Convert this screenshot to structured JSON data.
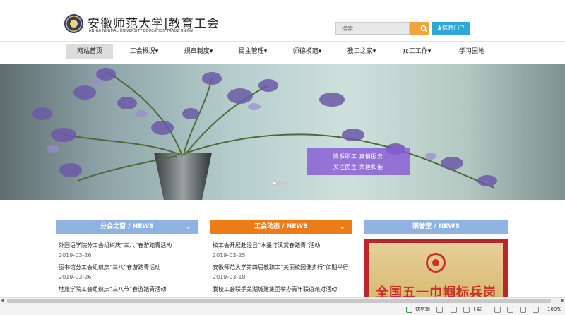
{
  "header": {
    "logo_cn": "安徽师范大学|教育工会",
    "logo_en": "ANHUI NORMAL UNIVERSITY EDUCATION    TRADE UNION",
    "search_placeholder": "搜索",
    "portal_label": "信息门户"
  },
  "nav": {
    "items": [
      {
        "label": "网站首页"
      },
      {
        "label": "工会概况▾"
      },
      {
        "label": "规章制度▾"
      },
      {
        "label": "民主管理▾"
      },
      {
        "label": "师德模范▾"
      },
      {
        "label": "教工之家▾"
      },
      {
        "label": "女工工作▾"
      },
      {
        "label": "学习园地"
      }
    ]
  },
  "banner": {
    "caption": {
      "line1": "情系职工    真情服务",
      "line2": "关注民生    共建和谐"
    }
  },
  "columns": [
    {
      "title": "分会之窗 / NEWS",
      "color": "#8fb3e0",
      "items": [
        {
          "title": "外国语学院分工会组织庆“三八”春游踏青活动",
          "date": "2019-03-26"
        },
        {
          "title": "图书馆分工会组织庆“三八”春游踏青活动",
          "date": "2019-03-26"
        },
        {
          "title": "地旅学院工会组织庆“三八节”春游踏青活动",
          "date": ""
        }
      ]
    },
    {
      "title": "工会动态 / NEWS",
      "color": "#ef7b16",
      "items": [
        {
          "title": "校工会开展赴泾县“水墨汀溪赏春踏青”活动",
          "date": "2019-03-25"
        },
        {
          "title": "安徽师范大学第四届教职工“美丽校园健步行”如期举行",
          "date": "2019-03-18"
        },
        {
          "title": "我校工会联手芜湖城建集团举办青年联谊派对活动",
          "date": ""
        }
      ]
    },
    {
      "title": "荣誉室 / NEWS",
      "color": "#8fb3e0",
      "honor_text": "全国五一巾帼标兵岗"
    }
  ],
  "statusbar": {
    "quick_clip": "快剪辑",
    "download": "下载",
    "zoom": "100%"
  }
}
